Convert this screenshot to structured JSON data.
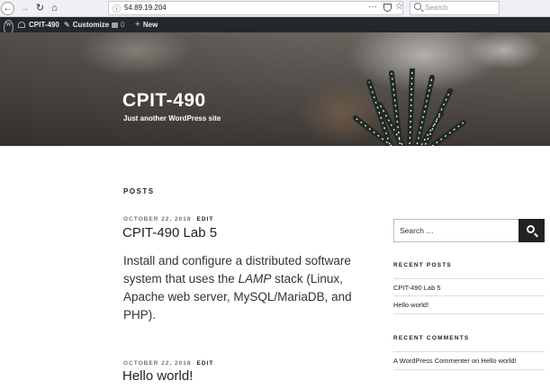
{
  "browser": {
    "url": "54.89.19.204",
    "search_placeholder": "Search",
    "icons": [
      "back-arrow-icon",
      "forward-arrow-icon",
      "reload-icon",
      "home-icon",
      "info-icon",
      "page-actions-icon",
      "pocket-icon",
      "bookmark-star-icon",
      "search-icon"
    ]
  },
  "admin_bar": {
    "site_name": "CPIT-490",
    "customize": "Customize",
    "comments_count": "0",
    "new": "New"
  },
  "header": {
    "site_title": "CPIT-490",
    "tagline": "Just another WordPress site"
  },
  "main": {
    "section_title": "POSTS",
    "posts": [
      {
        "date": "OCTOBER 22, 2018",
        "edit": "EDIT",
        "title": "CPIT-490 Lab 5",
        "excerpt_before": "Install and configure a distributed software system that uses the ",
        "excerpt_em": "LAMP",
        "excerpt_after": " stack (Linux, Apache web server, MySQL/MariaDB, and PHP)."
      },
      {
        "date": "OCTOBER 22, 2018",
        "edit": "EDIT",
        "title": "Hello world!"
      }
    ]
  },
  "sidebar": {
    "search_placeholder": "Search …",
    "recent_posts_title": "RECENT POSTS",
    "recent_posts": [
      "CPIT-490 Lab 5",
      "Hello world!"
    ],
    "recent_comments_title": "RECENT COMMENTS",
    "recent_comment": {
      "author": "A WordPress Commenter",
      "on": " on ",
      "post": "Hello world!"
    }
  },
  "colors": {
    "admin_bar_bg": "#23282d",
    "text_dark": "#222222",
    "meta_gray": "#767676"
  }
}
